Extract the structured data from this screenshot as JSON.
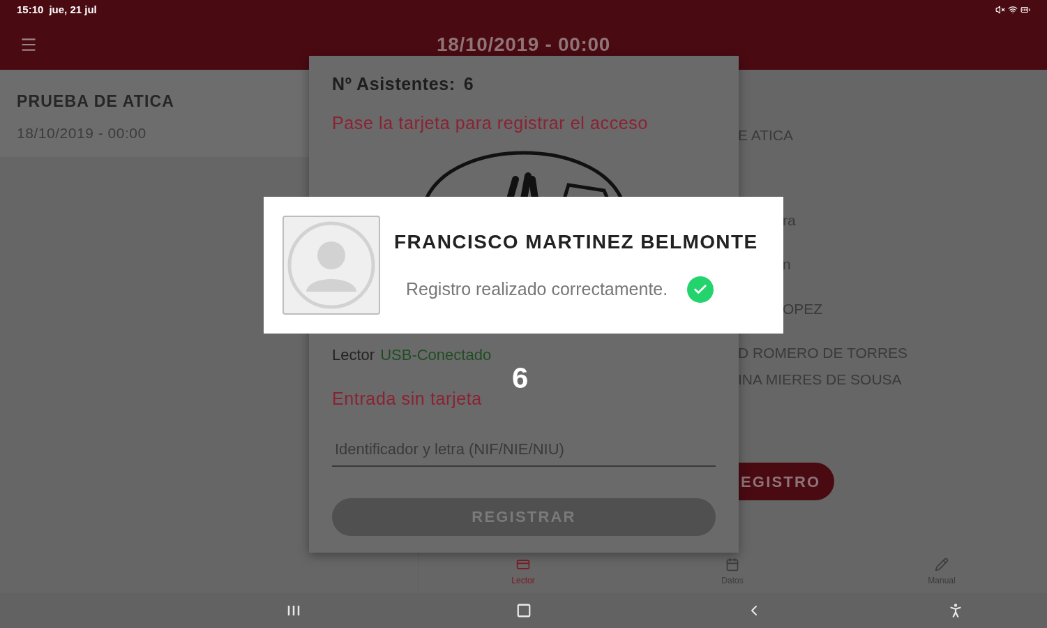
{
  "status_bar": {
    "time": "15:10",
    "date": "jue, 21 jul"
  },
  "app_bar": {
    "title": "18/10/2019 - 00:00"
  },
  "event_card": {
    "title": "PRUEBA DE ATICA",
    "date": "18/10/2019 - 00:00"
  },
  "details_panel": {
    "header": "E ATICA",
    "fields": [
      "ra",
      "n",
      "OPEZ"
    ],
    "names": [
      "D ROMERO DE TORRES",
      "INA MIERES DE SOUSA"
    ],
    "button": "EGISTRO"
  },
  "dialog": {
    "attendees_label": "Nº Asistentes:",
    "attendees_count": "6",
    "instruction": "Pase la tarjeta para registrar el acceso",
    "reader_label": "Lector",
    "reader_status": "USB-Conectado",
    "manual_entry_title": "Entrada sin tarjeta",
    "count_badge": "6",
    "id_field": {
      "placeholder": "Identificador y letra (NIF/NIE/NIU)"
    },
    "submit_button": {
      "label": "REGISTRAR",
      "disabled": true
    }
  },
  "toast": {
    "name": "FRANCISCO MARTINEZ BELMONTE",
    "message": "Registro realizado correctamente.",
    "success": true
  },
  "bottom_nav": [
    {
      "label": "Lector",
      "kind": "reader",
      "selected": true
    },
    {
      "label": "Datos",
      "kind": "data",
      "selected": false
    },
    {
      "label": "Manual",
      "kind": "manual",
      "selected": false
    }
  ]
}
